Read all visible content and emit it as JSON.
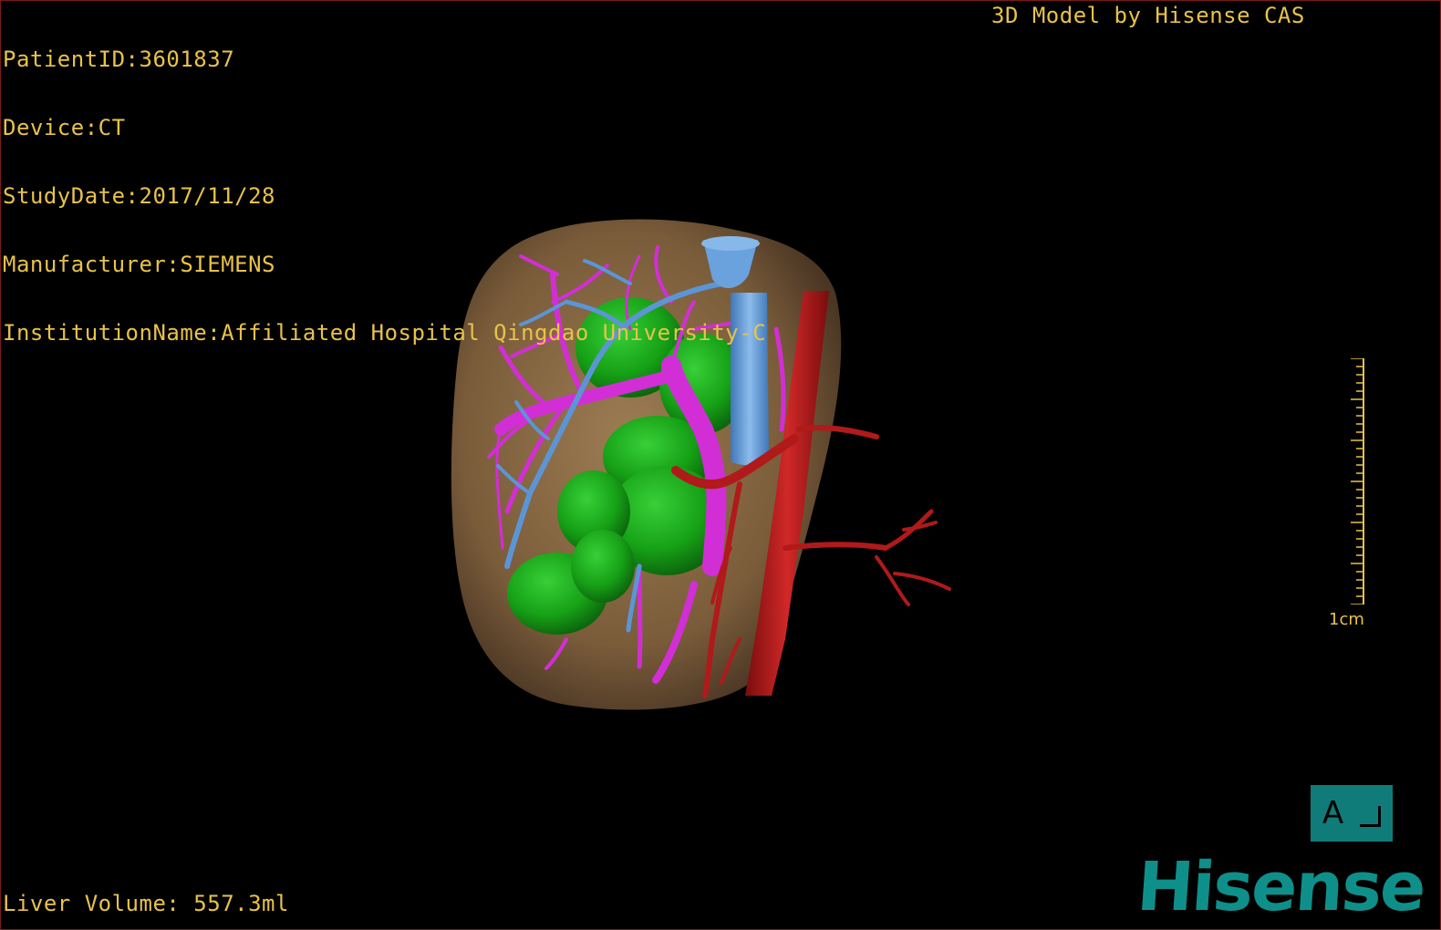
{
  "study_info": {
    "patient_id": "PatientID:3601837",
    "device": "Device:CT",
    "study_date": "StudyDate:2017/11/28",
    "manufacturer": "Manufacturer:SIEMENS",
    "institution": "InstitutionName:Affiliated Hospital Qingdao University-C"
  },
  "model_credit": "3D Model by Hisense CAS",
  "liver_volume": "Liver Volume: 557.3ml",
  "scale": {
    "label": "1cm"
  },
  "orientation": {
    "left_label": "A"
  },
  "brand": "Hisense",
  "colors": {
    "overlay_text": "#e8c24a",
    "liver": "#8a6b45",
    "portal_vein": "#d22ed6",
    "hepatic_vein": "#5c95d6",
    "tumor": "#1aa21a",
    "artery": "#b01a1a",
    "orientation_cube": "#0f7c7a",
    "brand": "#0f8f8a"
  }
}
